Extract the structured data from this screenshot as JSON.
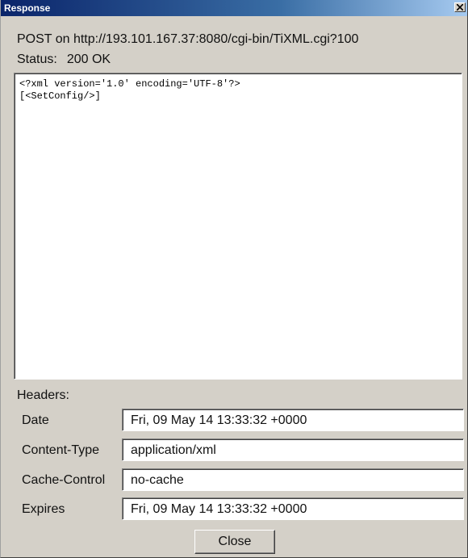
{
  "window": {
    "title": "Response"
  },
  "request": {
    "line": "POST on http://193.101.167.37:8080/cgi-bin/TiXML.cgi?100"
  },
  "status": {
    "label": "Status:",
    "value": "200 OK"
  },
  "body": {
    "content": "<?xml version='1.0' encoding='UTF-8'?>\n[<SetConfig/>]"
  },
  "headers": {
    "label": "Headers:",
    "rows": [
      {
        "name": "Date",
        "value": "Fri, 09 May 14 13:33:32 +0000"
      },
      {
        "name": "Content-Type",
        "value": "application/xml"
      },
      {
        "name": "Cache-Control",
        "value": "no-cache"
      },
      {
        "name": "Expires",
        "value": "Fri, 09 May 14 13:33:32 +0000"
      }
    ]
  },
  "buttons": {
    "close_label": "Close",
    "title_close_icon": "close-icon"
  },
  "colors": {
    "titlebar_start": "#0a246a",
    "titlebar_end": "#a6caf0",
    "face": "#d4d0c8"
  }
}
